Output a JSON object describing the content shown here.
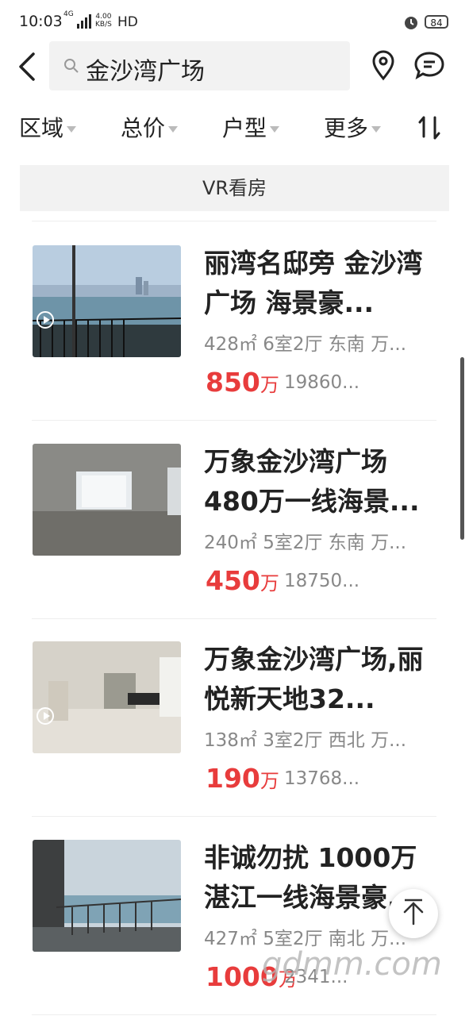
{
  "status_bar": {
    "time": "10:03",
    "network": "4G",
    "speed_value": "4.00",
    "speed_unit": "KB/S",
    "hd": "HD",
    "battery": "84"
  },
  "search": {
    "query": "金沙湾广场"
  },
  "filters": [
    "区域",
    "总价",
    "户型",
    "更多"
  ],
  "vr_button": "VR看房",
  "listings": [
    {
      "title": "丽湾名邸旁 金沙湾广场 海景豪...",
      "meta": "428㎡ 6室2厅 东南 万...",
      "price": "850",
      "price_unit": "万",
      "unit_price": "19860...",
      "has_video": true
    },
    {
      "title": "万象金沙湾广场480万一线海景...",
      "meta": "240㎡ 5室2厅 东南 万...",
      "price": "450",
      "price_unit": "万",
      "unit_price": "18750...",
      "has_video": false
    },
    {
      "title": "万象金沙湾广场,丽悦新天地32...",
      "meta": "138㎡ 3室2厅 西北 万...",
      "price": "190",
      "price_unit": "万",
      "unit_price": "13768...",
      "has_video": true
    },
    {
      "title": "非诚勿扰 1000万湛江一线海景豪...",
      "meta": "427㎡ 5室2厅 南北 万...",
      "price": "1000",
      "price_unit": "万",
      "unit_price": "2341...",
      "has_video": false
    }
  ],
  "watermark": "gdmm.com",
  "colors": {
    "price": "#e83c3c",
    "search_bg": "#f2f2f2"
  }
}
